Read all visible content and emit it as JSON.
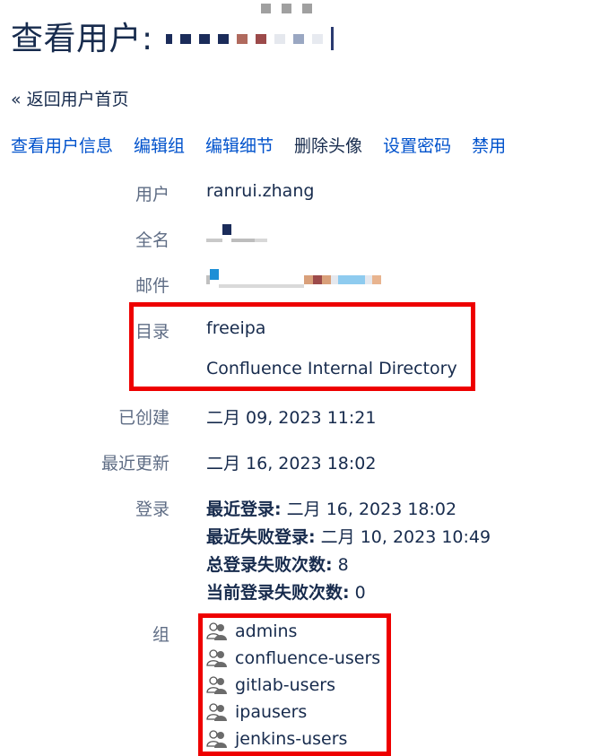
{
  "header": {
    "title": "查看用户:",
    "redacted_colors": [
      "#1b2c5a",
      "#1b2c5a",
      "#1b2c5a",
      "#1b2c5a",
      "#b06a5e",
      "#9c4a4a",
      "#e5e8ee",
      "#9aa7c2",
      "#e7eaf0",
      "#2a3a70"
    ]
  },
  "nav": {
    "back_label": "« 返回用户首页"
  },
  "actions": [
    {
      "label": "查看用户信息",
      "link": true
    },
    {
      "label": "编辑组",
      "link": true
    },
    {
      "label": "编辑细节",
      "link": true
    },
    {
      "label": "删除头像",
      "link": false
    },
    {
      "label": "设置密码",
      "link": true
    },
    {
      "label": "禁用",
      "link": true
    }
  ],
  "fields": {
    "user": {
      "label": "用户",
      "value": "ranrui.zhang"
    },
    "fullname": {
      "label": "全名"
    },
    "email": {
      "label": "邮件"
    },
    "directory": {
      "label": "目录",
      "values": [
        "freeipa",
        "Confluence Internal Directory"
      ]
    },
    "created": {
      "label": "已创建",
      "value": "二月 09, 2023 11:21"
    },
    "updated": {
      "label": "最近更新",
      "value": "二月 16, 2023 18:02"
    },
    "login": {
      "label": "登录",
      "last_login_label": "最近登录:",
      "last_login_value": " 二月 16, 2023 18:02",
      "last_failed_label": "最近失败登录:",
      "last_failed_value": " 二月 10, 2023 10:49",
      "total_failed_label": "总登录失败次数:",
      "total_failed_value": " 8",
      "current_failed_label": "当前登录失败次数:",
      "current_failed_value": " 0"
    },
    "groups": {
      "label": "组",
      "items": [
        "admins",
        "confluence-users",
        "gitlab-users",
        "ipausers",
        "jenkins-users"
      ]
    }
  },
  "colors": {
    "link": "#0052cc",
    "text": "#172b4d",
    "label": "#5e6c84",
    "highlight": "#ee0000"
  }
}
